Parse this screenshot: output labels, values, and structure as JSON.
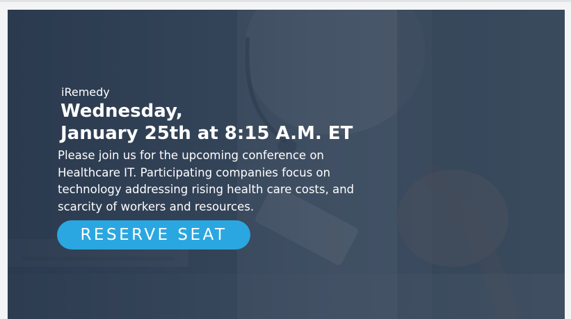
{
  "banner": {
    "brand": "iRemedy",
    "date_line1": "Wednesday,",
    "date_line2": "January 25th at 8:15 A.M. ET",
    "description_lines": [
      "Please join us for the upcoming conference on",
      "Healthcare IT. Participating companies focus on",
      "technology addressing rising health care costs, and",
      "scarcity of workers and resources."
    ],
    "cta_label": "RESERVE SEAT"
  },
  "colors": {
    "overlay": "#243246",
    "accent_button": "#2aa7e0",
    "text": "#ffffff"
  }
}
